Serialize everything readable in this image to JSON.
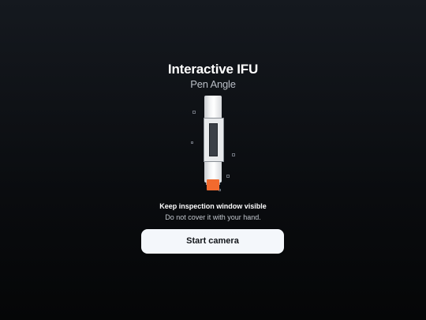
{
  "header": {
    "title": "Interactive IFU",
    "subtitle": "Pen Angle"
  },
  "illustration": {
    "icon": "injection-pen-icon",
    "cap_color": "#f26a2e"
  },
  "instruction": {
    "heading": "Keep inspection window visible",
    "text": "Do not cover it with your hand."
  },
  "actions": {
    "start_camera_label": "Start camera"
  },
  "colors": {
    "accent": "#f26a2e",
    "button_bg": "#f4f7fb",
    "background": "#0a0c0f"
  }
}
